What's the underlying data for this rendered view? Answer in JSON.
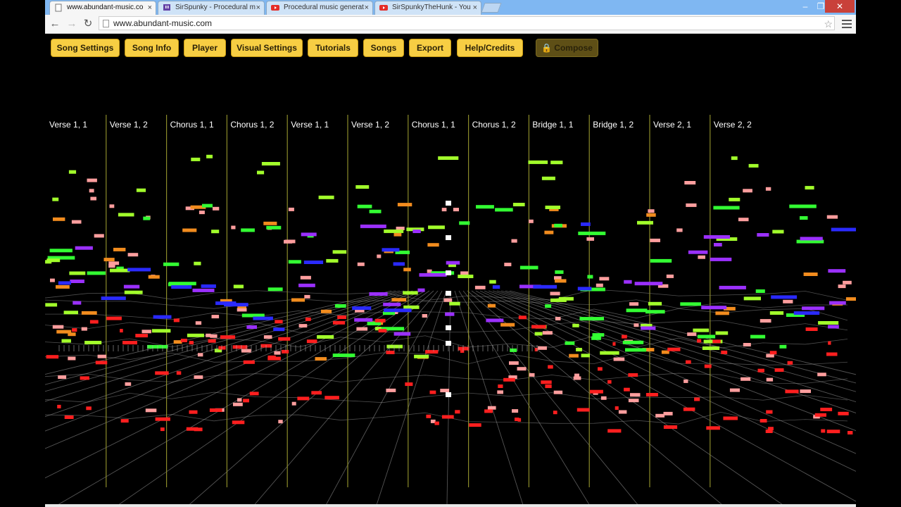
{
  "browser": {
    "tabs": [
      {
        "title": "www.abundant-music.co",
        "favicon": "page-icon",
        "active": true
      },
      {
        "title": "SirSpunky - Procedural m",
        "favicon": "twitch-icon",
        "active": false
      },
      {
        "title": "Procedural music generat",
        "favicon": "youtube-icon",
        "active": false
      },
      {
        "title": "SirSpunkyTheHunk - You",
        "favicon": "youtube-icon",
        "active": false
      }
    ],
    "url": "www.abundant-music.com",
    "tab_close": "×"
  },
  "app": {
    "menu": [
      "Song Settings",
      "Song Info",
      "Player",
      "Visual Settings",
      "Tutorials",
      "Songs",
      "Export",
      "Help/Credits"
    ],
    "compose_label": "Compose",
    "sections": [
      "Verse 1, 1",
      "Verse 1, 2",
      "Chorus 1, 1",
      "Chorus 1, 2",
      "Verse 1, 1",
      "Verse 1, 2",
      "Chorus 1, 1",
      "Chorus 1, 2",
      "Bridge 1, 1",
      "Bridge 1, 2",
      "Verse 2, 1",
      "Verse 2, 2"
    ]
  },
  "colors": {
    "background": "#000000",
    "button": "#f7ce43",
    "divider": "#8b8b2a",
    "grid": "#9a9a9a",
    "note_colors": [
      "#ff9e9e",
      "#f28c1e",
      "#33ff33",
      "#a2ff2b",
      "#9b30ff",
      "#2a2aff",
      "#ff1f1f",
      "#ffffff"
    ]
  },
  "icons": {
    "back": "back-arrow-icon",
    "forward": "forward-arrow-icon",
    "reload": "reload-icon",
    "bookmark": "star-icon",
    "menu": "hamburger-menu-icon",
    "lock": "lock-icon"
  }
}
